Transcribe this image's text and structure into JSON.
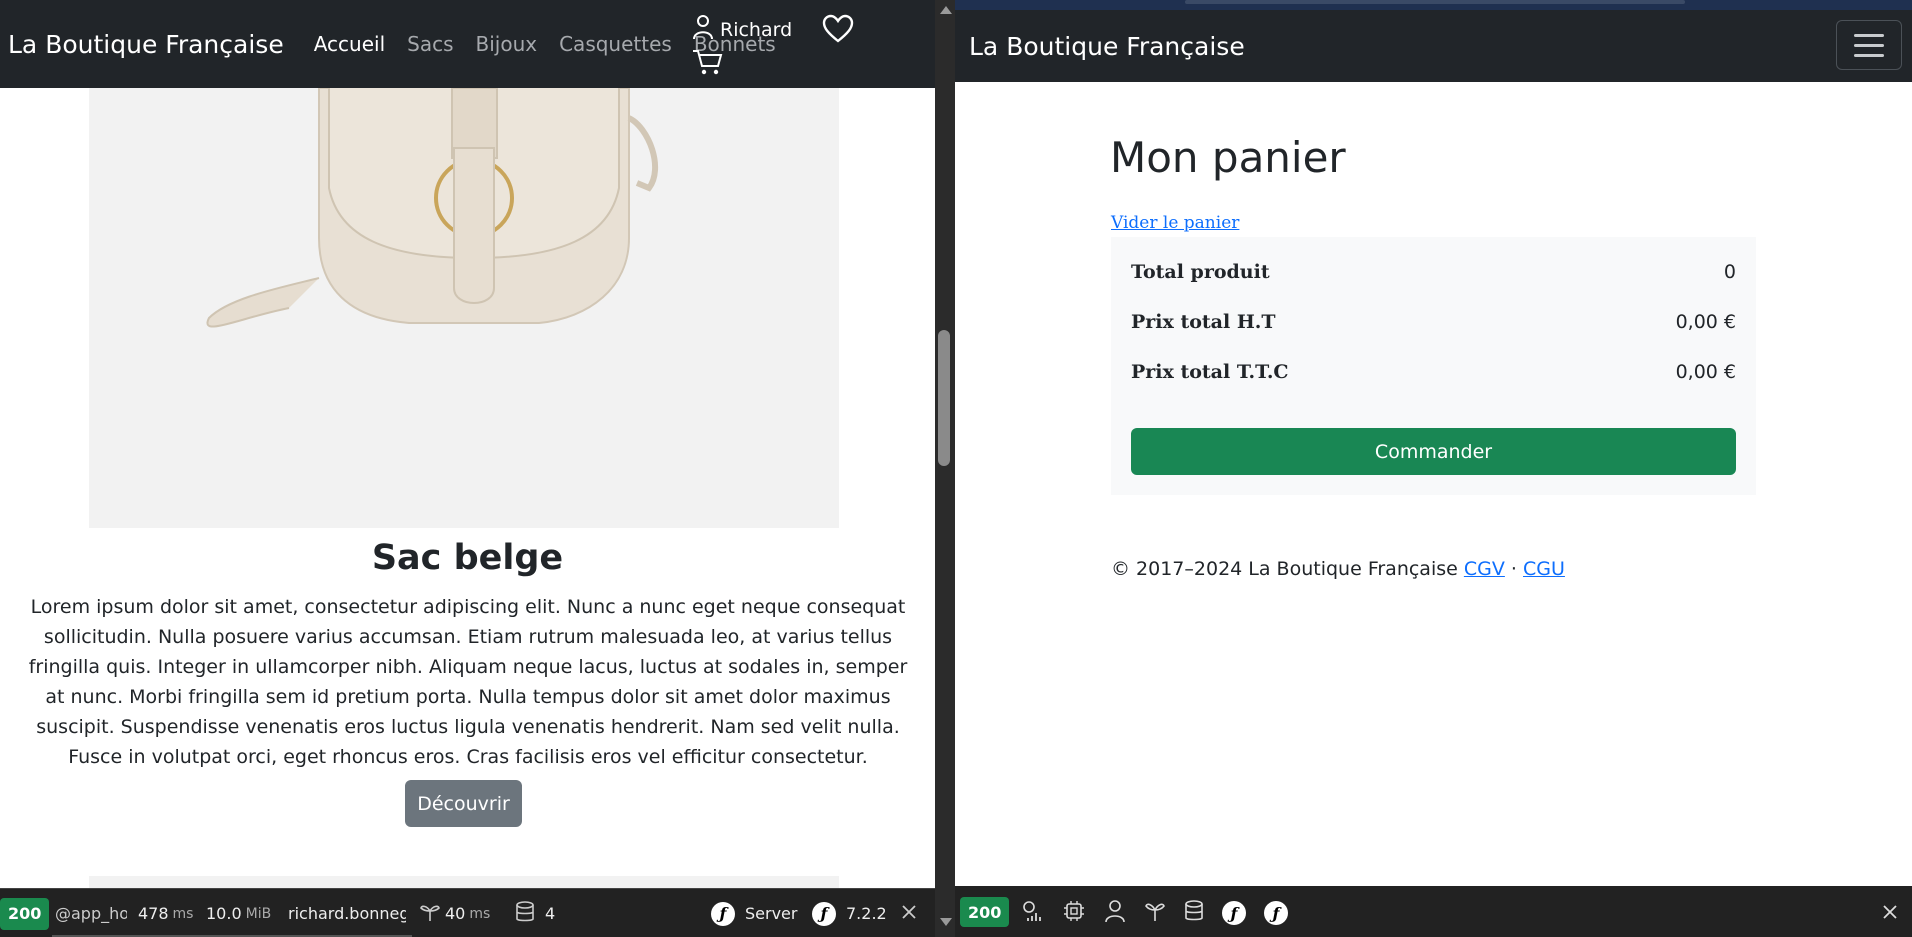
{
  "left": {
    "navbar": {
      "brand": "La Boutique Française",
      "menu": [
        "Accueil",
        "Sacs",
        "Bijoux",
        "Casquettes",
        "Bonnets"
      ],
      "active_index": 0,
      "user_name": "Richard"
    },
    "product": {
      "title": "Sac belge",
      "description": "Lorem ipsum dolor sit amet, consectetur adipiscing elit. Nunc a nunc eget neque consequat sollicitudin. Nulla posuere varius accumsan. Etiam rutrum malesuada leo, at varius tellus fringilla quis. Integer in ullamcorper nibh. Aliquam neque lacus, luctus at sodales in, semper at nunc. Morbi fringilla sem id pretium porta. Nulla tempus dolor sit amet dolor maximus suscipit. Suspendisse venenatis eros luctus ligula venenatis hendrerit. Nam sed velit nulla. Fusce in volutpat orci, eget rhoncus eros. Cras facilisis eros vel efficitur consectetur.",
      "button": "Découvrir"
    },
    "toolbar": {
      "status": "200",
      "route": "@app_hor",
      "time_value": "478",
      "time_unit": "ms",
      "memory_value": "10.0",
      "memory_unit": "MiB",
      "user": "richard.bonnege",
      "twig_value": "40",
      "twig_unit": "ms",
      "db_queries": "4",
      "server_label": "Server",
      "version": "7.2.2"
    }
  },
  "right": {
    "navbar": {
      "brand": "La Boutique Française"
    },
    "cart": {
      "title": "Mon panier",
      "empty_link": "Vider le panier",
      "rows": [
        {
          "label": "Total produit",
          "value": "0"
        },
        {
          "label": "Prix total H.T",
          "value": "0,00 €"
        },
        {
          "label": "Prix total T.T.C",
          "value": "0,00 €"
        }
      ],
      "order_button": "Commander"
    },
    "footer": {
      "text": "© 2017–2024 La Boutique Française",
      "cgv": "CGV",
      "separator": "·",
      "cgu": "CGU"
    },
    "toolbar": {
      "status": "200"
    }
  },
  "colors": {
    "navbar_bg": "#212529",
    "success": "#198754",
    "secondary": "#6c757d",
    "link": "#0d6efd",
    "toolbar_status": "#1a8a4e"
  },
  "icons": [
    "user-icon",
    "cart-icon",
    "heart-icon",
    "menu-icon",
    "close-icon",
    "symfony-icon",
    "database-icon",
    "twig-icon",
    "profiler-icon",
    "cpu-icon"
  ]
}
